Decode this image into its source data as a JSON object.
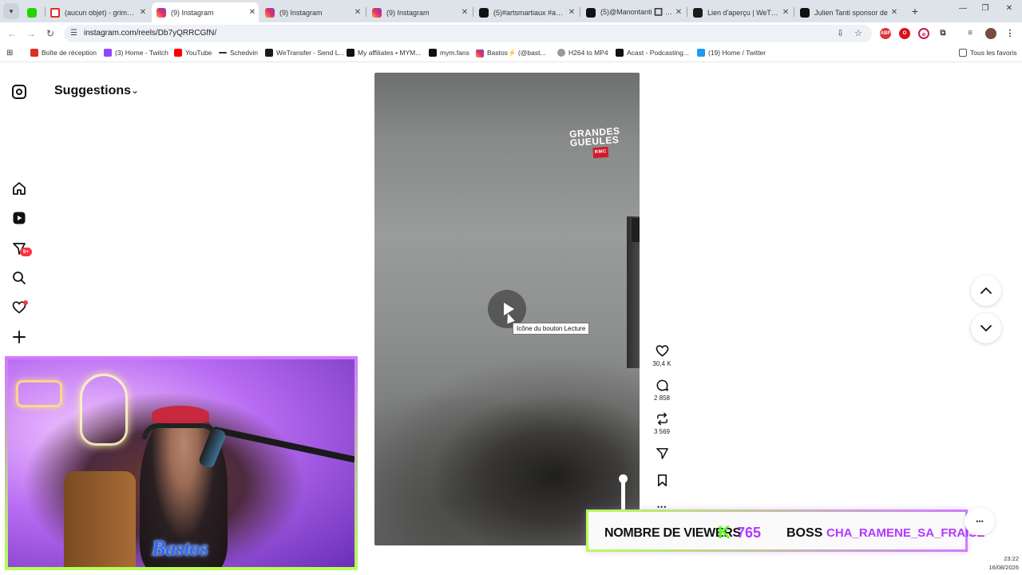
{
  "browser": {
    "tabs": [
      {
        "label": "",
        "icon": "kick-icon"
      },
      {
        "label": "(aucun objet) - grimalba",
        "icon": "gmail-icon"
      },
      {
        "label": "(9) Instagram",
        "icon": "instagram-icon",
        "active": true
      },
      {
        "label": "(9) Instagram",
        "icon": "instagram-icon"
      },
      {
        "label": "(9) Instagram",
        "icon": "instagram-icon"
      },
      {
        "label": "(5)#artsmartiaux #analys",
        "icon": "tiktok-icon"
      },
      {
        "label": "(5)@Manontanti 🔲 | TikT",
        "icon": "tiktok-icon"
      },
      {
        "label": "Lien d'aperçu | WeTransf",
        "icon": "wetransfer-icon"
      },
      {
        "label": "Julien Tanti sponsor de",
        "icon": "tiktok-icon"
      }
    ],
    "url": "instagram.com/reels/Db7yQRRCGfN/",
    "bookmarks": [
      {
        "label": "Boîte de réception",
        "color": "#d93025"
      },
      {
        "label": "(3) Home - Twitch",
        "color": "#9146ff"
      },
      {
        "label": "YouTube",
        "color": "#ff0000"
      },
      {
        "label": "Schedvin",
        "color": "#333333"
      },
      {
        "label": "WeTransfer - Send L...",
        "color": "#1b1b1b"
      },
      {
        "label": "My affiliates • MYM...",
        "color": "#111111"
      },
      {
        "label": "mym.fans",
        "color": "#111111"
      },
      {
        "label": "Bastos⚡ (@bast...",
        "color": "#e1306c"
      },
      {
        "label": "H264 to MP4",
        "color": "#888888"
      },
      {
        "label": "Acast - Podcasting...",
        "color": "#111111"
      },
      {
        "label": "(19) Home / Twitter",
        "color": "#1d9bf0"
      }
    ],
    "all_bookmarks": "Tous les favoris"
  },
  "instagram": {
    "section_title": "Suggestions",
    "nav_badge": "9+",
    "tooltip": "Icône du bouton Lecture",
    "video_watermark": {
      "line1": "GRANDES",
      "line2": "GUEULES",
      "tag": "RMC"
    },
    "actions": {
      "likes": "30,4 K",
      "comments": "2 858",
      "reposts": "3 569"
    }
  },
  "overlay": {
    "cam_logo": "Bastos",
    "viewers_label": "NOMBRE DE VIEWERS",
    "viewers_k": "K",
    "viewers_count": "765",
    "boss_label": "BOSS",
    "boss_name": "CHA_RAMENE_SA_FRAISE"
  },
  "clock": {
    "time": "23:22",
    "date": "16/08/2026"
  }
}
